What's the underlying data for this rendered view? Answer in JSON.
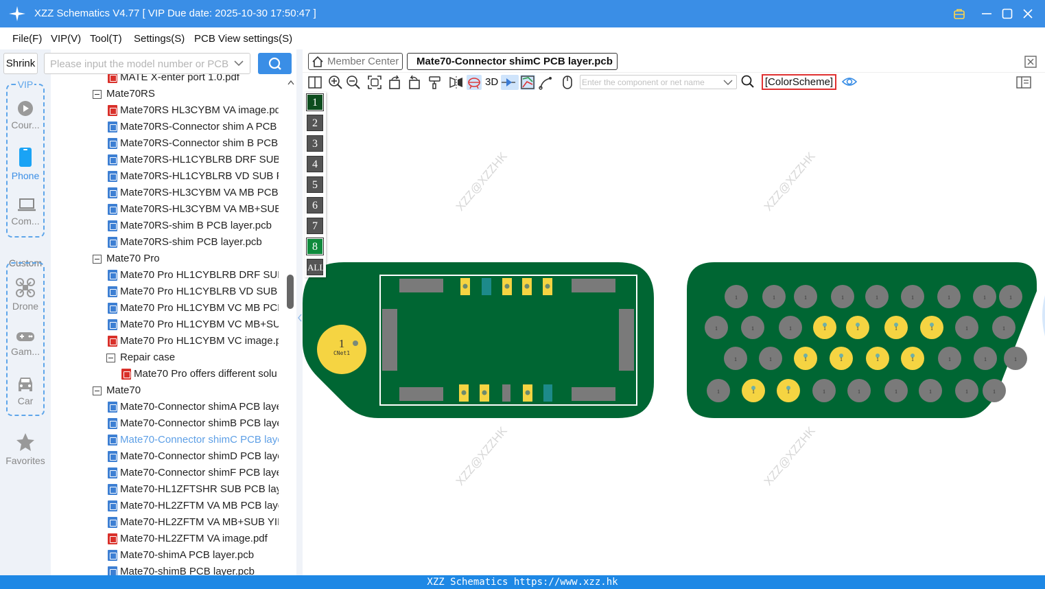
{
  "window": {
    "title": "XZZ Schematics V4.77 [ VIP Due date: 2025-10-30 17:50:47 ]",
    "icons": [
      "app-logo-icon",
      "vip-badge-icon",
      "minimize-icon",
      "maximize-icon",
      "close-icon"
    ]
  },
  "menu": [
    "File(F)",
    "VIP(V)",
    "Tool(T)",
    "Settings(S)",
    "PCB View settings(S)"
  ],
  "left_rail": {
    "vip_label": "VIP",
    "vip_items": [
      "Cour...",
      "Phone",
      "Com..."
    ],
    "custom_label": "Custom",
    "custom_items": [
      "Drone",
      "Gam...",
      "Car"
    ],
    "favorites_label": "Favorites",
    "active_item": "Phone"
  },
  "sidebar": {
    "shrink_label": "Shrink",
    "search_placeholder": "Please input the model number or PCB",
    "tree": [
      {
        "kind": "pdf",
        "depth": 2,
        "label": "MATE X-enter port 1.0.pdf"
      },
      {
        "kind": "folder",
        "depth": 1,
        "label": "Mate70RS"
      },
      {
        "kind": "pdf",
        "depth": 2,
        "label": "Mate70RS HL3CYBM VA image.pdf"
      },
      {
        "kind": "pcb",
        "depth": 2,
        "label": "Mate70RS-Connector shim A PCB l"
      },
      {
        "kind": "pcb",
        "depth": 2,
        "label": "Mate70RS-Connector shim B PCB l"
      },
      {
        "kind": "pcb",
        "depth": 2,
        "label": "Mate70RS-HL1CYBLRB DRF SUB PC"
      },
      {
        "kind": "pcb",
        "depth": 2,
        "label": "Mate70RS-HL1CYBLRB VD SUB PCI"
      },
      {
        "kind": "pcb",
        "depth": 2,
        "label": "Mate70RS-HL3CYBM VA MB PCB la"
      },
      {
        "kind": "pcb",
        "depth": 2,
        "label": "Mate70RS-HL3CYBM VA MB+SUB"
      },
      {
        "kind": "pcb",
        "depth": 2,
        "label": "Mate70RS-shim B PCB layer.pcb"
      },
      {
        "kind": "pcb",
        "depth": 2,
        "label": "Mate70RS-shim PCB layer.pcb"
      },
      {
        "kind": "folder",
        "depth": 1,
        "label": "Mate70 Pro"
      },
      {
        "kind": "pcb",
        "depth": 2,
        "label": "Mate70 Pro HL1CYBLRB DRF SUB F"
      },
      {
        "kind": "pcb",
        "depth": 2,
        "label": "Mate70 Pro HL1CYBLRB VD SUB PC"
      },
      {
        "kind": "pcb",
        "depth": 2,
        "label": "Mate70 Pro HL1CYBM VC MB PCB"
      },
      {
        "kind": "pcb",
        "depth": 2,
        "label": "Mate70 Pro HL1CYBM VC MB+SUE"
      },
      {
        "kind": "pdf",
        "depth": 2,
        "label": "Mate70 Pro HL1CYBM VC image.pc"
      },
      {
        "kind": "folder",
        "depth": 2,
        "label": "Repair case"
      },
      {
        "kind": "pdf",
        "depth": 3,
        "label": "Mate70 Pro offers different solu"
      },
      {
        "kind": "folder",
        "depth": 1,
        "label": "Mate70"
      },
      {
        "kind": "pcb",
        "depth": 2,
        "label": "Mate70-Connector shimA PCB laye"
      },
      {
        "kind": "pcb",
        "depth": 2,
        "label": "Mate70-Connector shimB PCB laye"
      },
      {
        "kind": "pcb",
        "depth": 2,
        "label": "Mate70-Connector shimC PCB laye",
        "selected": true
      },
      {
        "kind": "pcb",
        "depth": 2,
        "label": "Mate70-Connector shimD PCB laye"
      },
      {
        "kind": "pcb",
        "depth": 2,
        "label": "Mate70-Connector shimF PCB laye"
      },
      {
        "kind": "pcb",
        "depth": 2,
        "label": "Mate70-HL1ZFTSHR SUB PCB layer"
      },
      {
        "kind": "pcb",
        "depth": 2,
        "label": "Mate70-HL2ZFTM VA MB PCB laye"
      },
      {
        "kind": "pcb",
        "depth": 2,
        "label": "Mate70-HL2ZFTM VA MB+SUB YIE"
      },
      {
        "kind": "pdf",
        "depth": 2,
        "label": "Mate70-HL2ZFTM VA image.pdf"
      },
      {
        "kind": "pcb",
        "depth": 2,
        "label": "Mate70-shimA PCB layer.pcb"
      },
      {
        "kind": "pcb",
        "depth": 2,
        "label": "Mate70-shimB PCB layer.pcb"
      }
    ]
  },
  "tabs": {
    "member_center": "Member Center",
    "active_tab": "Mate70-Connector shimC PCB layer.pcb"
  },
  "toolbar": {
    "label_3d": "3D",
    "component_search_placeholder": "Enter the component or net name",
    "color_scheme": "[ColorScheme]"
  },
  "layers": [
    "1",
    "2",
    "3",
    "4",
    "5",
    "6",
    "7",
    "8",
    "ALL"
  ],
  "layers_active": [
    "1",
    "8"
  ],
  "pcb": {
    "watermark": "XZZ@XZZHK",
    "test_point_label": "1",
    "test_point_net": "CNet1",
    "pin_label": "1",
    "colors": {
      "board": "#006633",
      "pad": "#f5d442",
      "gray_pad": "#7a7a7a",
      "accent": "#3a8ee6"
    }
  },
  "statusbar": "XZZ Schematics https://www.xzz.hk"
}
